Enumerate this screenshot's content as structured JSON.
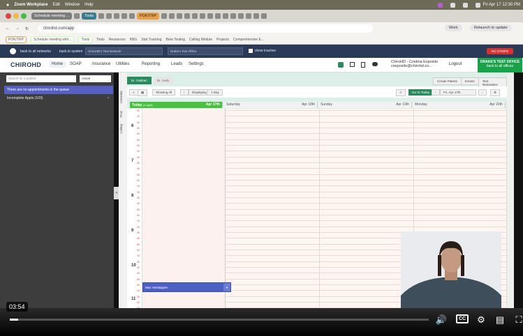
{
  "mac": {
    "app": "Zoom Workplace",
    "menus": [
      "Edit",
      "Window",
      "Help"
    ],
    "clock": "Fri Apr 17 12:30 PM"
  },
  "tabs": [
    {
      "label": "Schedule meeting ..."
    },
    {
      "label": "Tools"
    },
    {
      "label": "POK/TRP"
    }
  ],
  "url": {
    "address": "chirohd.com/app",
    "profile": "Work",
    "relaunch": "Relaunch to update"
  },
  "bookmarks": [
    "POK/TRP",
    "Schedule meeting with...",
    "Tools",
    "Tools",
    "Resources",
    "KBG",
    "Stat Tracking",
    "Beta Testing",
    "Calling Module",
    "Projects",
    "Comprehensive E..."
  ],
  "appbar": {
    "back_network": "back to all networks",
    "back_system": "back to system",
    "network": "ChiroHD's Test Network",
    "office": "Drake's Test Office",
    "show_inactive": "show inactive",
    "no_strips": "NO STRIPS"
  },
  "nav": {
    "logo": "CHIROHD",
    "items": [
      "Home",
      "SOAP",
      "Insurance",
      "Utilities",
      "Reporting",
      "Leads",
      "Settings"
    ],
    "user_name": "ChiroHD - Cristina Esposito",
    "user_email": "cesposito@chirohd.co...",
    "logout": "Logout",
    "office_name": "DRAKE'S TEST OFFICE",
    "office_back": "back to all offices"
  },
  "sidebar": {
    "search_placeholder": "Search for a patient",
    "status": "Active",
    "queue_msg": "There are no appointments in the queue",
    "incomplete": "Incomplete Appts (103)"
  },
  "vtabs": [
    "Calendar",
    "Flow",
    "Calling"
  ],
  "calendar": {
    "doctor_tabs": [
      "Dr. Oakban",
      "Dr. Joely"
    ],
    "buttons": [
      "Create Patient",
      "Events",
      "Text Reminders"
    ],
    "showing": "Showing All",
    "displaying": "Displaying",
    "range": "1 Day",
    "goto": "Go To Today",
    "date": "Fri, Apr 17th",
    "days": [
      {
        "name": "Today",
        "sub": "(1 appt)",
        "date": "Apr 17th"
      },
      {
        "name": "Saturday",
        "date": "Apr 18th"
      },
      {
        "name": "Sunday",
        "date": "Apr 19th"
      },
      {
        "name": "Monday",
        "date": "Apr 20th"
      }
    ],
    "hours": [
      "6",
      "7",
      "8",
      "9",
      "10",
      "11"
    ],
    "appointment": "Max Verstappen"
  },
  "video": {
    "timestamp": "03:54",
    "progress_pct": 2
  }
}
